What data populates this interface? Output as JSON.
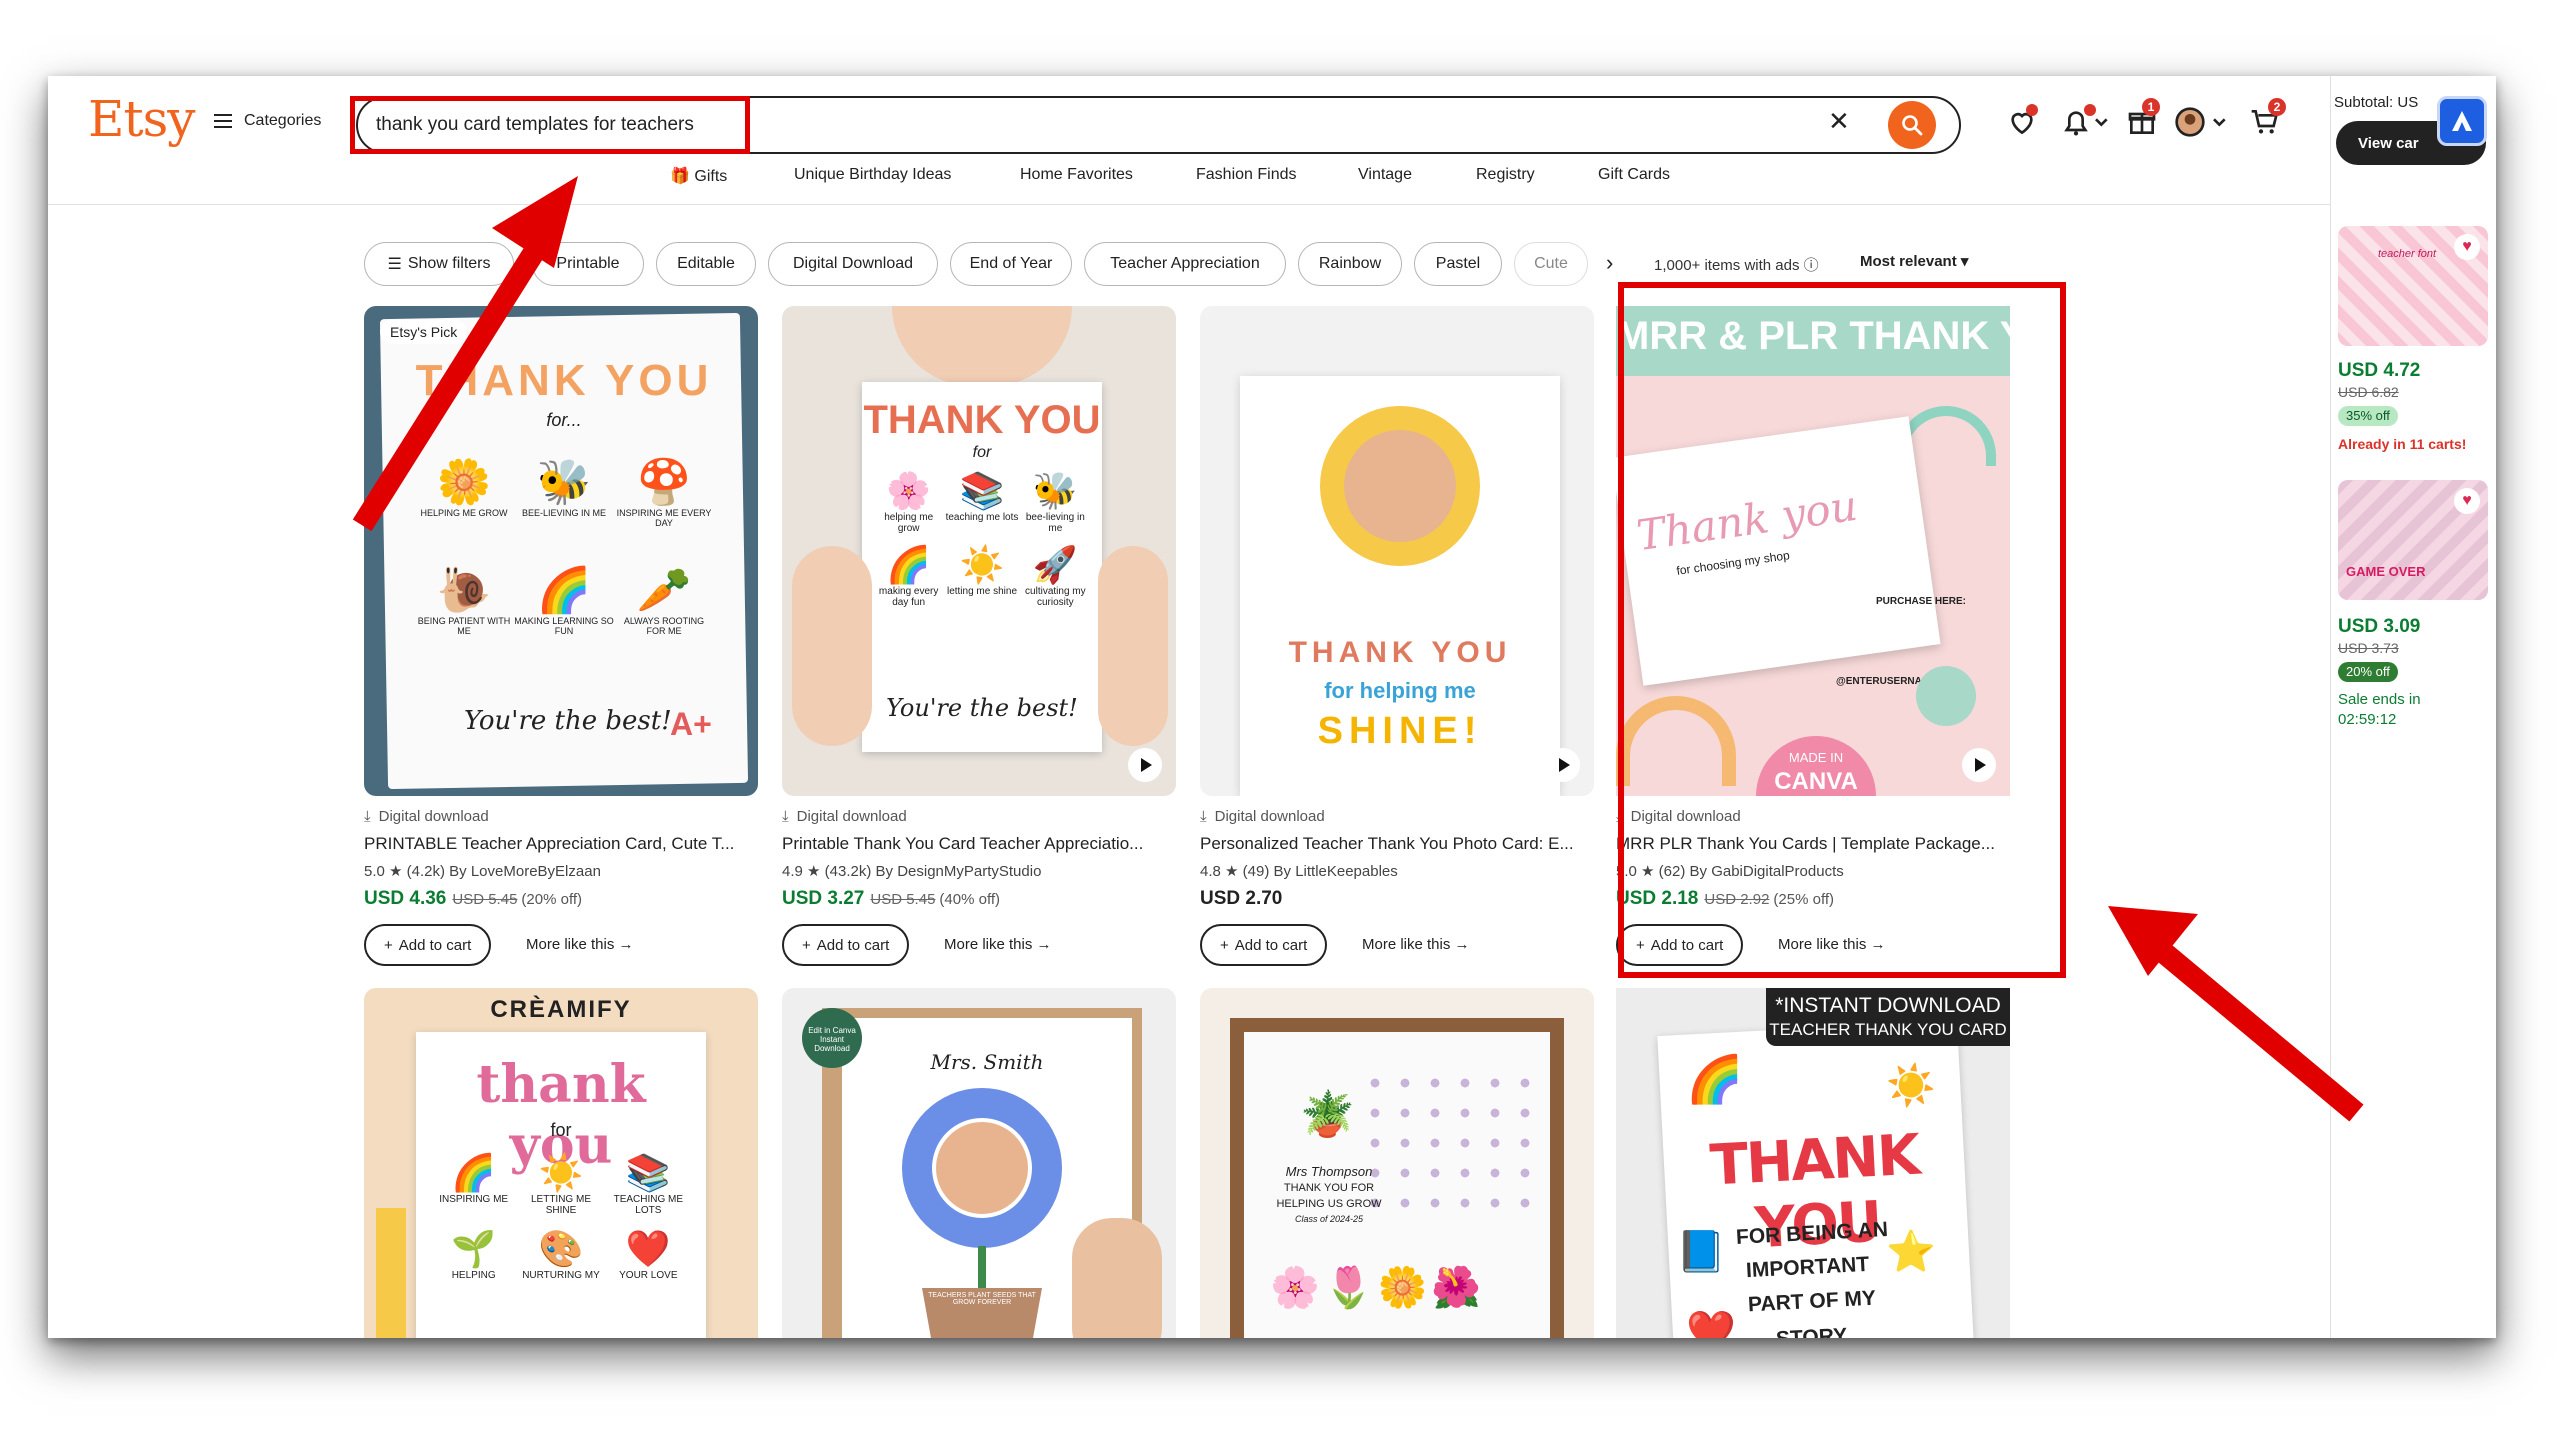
{
  "app": {
    "logo": "Etsy",
    "categories": "Categories"
  },
  "search": {
    "query": "thank you card templates for teachers"
  },
  "header": {
    "favorites_badge": "",
    "cart_badge": "2",
    "gift_badge": "1"
  },
  "nav": [
    "Gifts",
    "Unique Birthday Ideas",
    "Home Favorites",
    "Fashion Finds",
    "Vintage",
    "Registry",
    "Gift Cards"
  ],
  "filters": {
    "show_filters": "Show filters",
    "chips": [
      "Printable",
      "Editable",
      "Digital Download",
      "End of Year",
      "Teacher Appreciation",
      "Rainbow",
      "Pastel",
      "Cute"
    ],
    "results": "1,000+ items with ads",
    "sort": "Most relevant"
  },
  "listings": [
    {
      "badge": "Etsy's Pick",
      "type": "Digital download",
      "title": "PRINTABLE Teacher Appreciation Card, Cute T...",
      "rating": "5.0",
      "reviews": "(4.2k)",
      "shop": "By LoveMoreByElzaan",
      "price": "USD 4.36",
      "old": "USD 5.45",
      "off": "(20% off)",
      "art": {
        "h1": "THANK YOU",
        "h2": "for...",
        "items": [
          "HELPING ME GROW",
          "BEE-LIEVING IN ME",
          "INSPIRING ME EVERY DAY",
          "BEING PATIENT WITH ME",
          "MAKING LEARNING SO FUN",
          "ALWAYS ROOTING FOR ME"
        ],
        "footer": "You're the best!",
        "grade": "A+"
      }
    },
    {
      "type": "Digital download",
      "title": "Printable Thank You Card Teacher Appreciatio...",
      "rating": "4.9",
      "reviews": "(43.2k)",
      "shop": "By DesignMyPartyStudio",
      "price": "USD 3.27",
      "old": "USD 5.45",
      "off": "(40% off)",
      "art": {
        "h1": "THANK YOU",
        "h2": "for",
        "items": [
          "helping me grow",
          "teaching me lots",
          "bee-lieving in me",
          "making every day fun",
          "letting me shine",
          "cultivating my curiosity"
        ],
        "footer": "You're the best!"
      }
    },
    {
      "type": "Digital download",
      "title": "Personalized Teacher Thank You Photo Card: E...",
      "rating": "4.8",
      "reviews": "(49)",
      "shop": "By LittleKeepables",
      "price": "USD 2.70",
      "art": {
        "h1": "THANK YOU",
        "h2": "for helping me",
        "h3": "SHINE!"
      }
    },
    {
      "type": "Digital download",
      "title": "MRR PLR Thank You Cards | Template Package...",
      "rating": "5.0",
      "reviews": "(62)",
      "shop": "By GabiDigitalProducts",
      "price": "USD 2.18",
      "old": "USD 2.92",
      "off": "(25% off)",
      "art": {
        "banner": "MRR & PLR THANK YOU CARDS",
        "script": "Thank you",
        "sub": "for choosing my shop",
        "purchase": "PURCHASE HERE:",
        "user": "@ENTERUSERNAME",
        "made": "MADE IN",
        "canva": "CANVA"
      }
    },
    {
      "art": {
        "banner": "CRÈAMIFY",
        "h1": "thank you",
        "h2": "for",
        "items": [
          "INSPIRING ME",
          "LETTING ME SHINE",
          "TEACHING ME LOTS",
          "HELPING",
          "NURTURING MY",
          "YOUR LOVE"
        ]
      }
    },
    {
      "art": {
        "name": "Mrs. Smith",
        "pot": "TEACHERS PLANT SEEDS THAT GROW FOREVER",
        "stamp": "Edit in Canva Instant Download"
      }
    },
    {
      "art": {
        "l1": "Mrs Thompson",
        "l2": "THANK YOU FOR",
        "l3": "HELPING US GROW",
        "l4": "Class of 2024-25"
      }
    },
    {
      "art": {
        "banner1": "*INSTANT DOWNLOAD",
        "banner2": "TEACHER THANK YOU CARD",
        "h1": "THANK YOU",
        "l1": "FOR BEING AN",
        "l2": "IMPORTANT",
        "l3": "PART OF MY",
        "l4": "STORY"
      }
    }
  ],
  "ui": {
    "add_to_cart": "Add to cart",
    "more_like_this": "More like this"
  },
  "cart_panel": {
    "subtotal": "Subtotal: US",
    "view_cart": "View car",
    "items": [
      {
        "thumb": "teacher font",
        "price": "USD 4.72",
        "old": "USD 6.82",
        "off": "35% off",
        "note": "Already in 11 carts!"
      },
      {
        "thumb": "GAME OVER",
        "price": "USD 3.09",
        "old": "USD 3.73",
        "off": "20% off",
        "note1": "Sale ends in",
        "note2": "02:59:12"
      }
    ]
  },
  "colors": {
    "brand": "#f1641e",
    "sale": "#0a7d32",
    "annotation": "#e00000"
  }
}
